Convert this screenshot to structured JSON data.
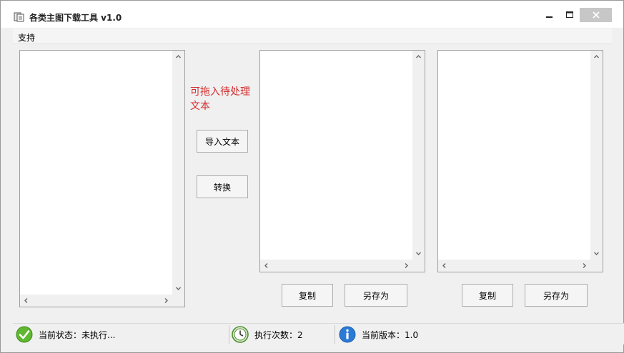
{
  "window": {
    "title": "各类主图下载工具 v1.0",
    "app_icon": "document-stack-icon",
    "controls": [
      "minimize-icon",
      "maximize-icon",
      "close-icon"
    ]
  },
  "menu": {
    "items": [
      {
        "label": "支持"
      }
    ]
  },
  "hint": {
    "text": "可拖入待处理文本",
    "color": "#d42a2a"
  },
  "buttons": {
    "import_text": "导入文本",
    "convert": "转换",
    "copy_1": "复制",
    "save_as_1": "另存为",
    "copy_2": "复制",
    "save_as_2": "另存为"
  },
  "textboxes": {
    "input": {
      "value": ""
    },
    "output_1": {
      "value": ""
    },
    "output_2": {
      "value": ""
    }
  },
  "status": {
    "state": {
      "icon": "checkmark-icon",
      "text": "当前状态：未执行..."
    },
    "count": {
      "icon": "history-clock-icon",
      "text": "执行次数：2"
    },
    "version": {
      "icon": "info-icon",
      "text": "当前版本：1.0"
    }
  },
  "colors": {
    "window_bg": "#f0f0f0",
    "status_ok": "#5fb82f",
    "info_blue": "#2b7bd6"
  }
}
